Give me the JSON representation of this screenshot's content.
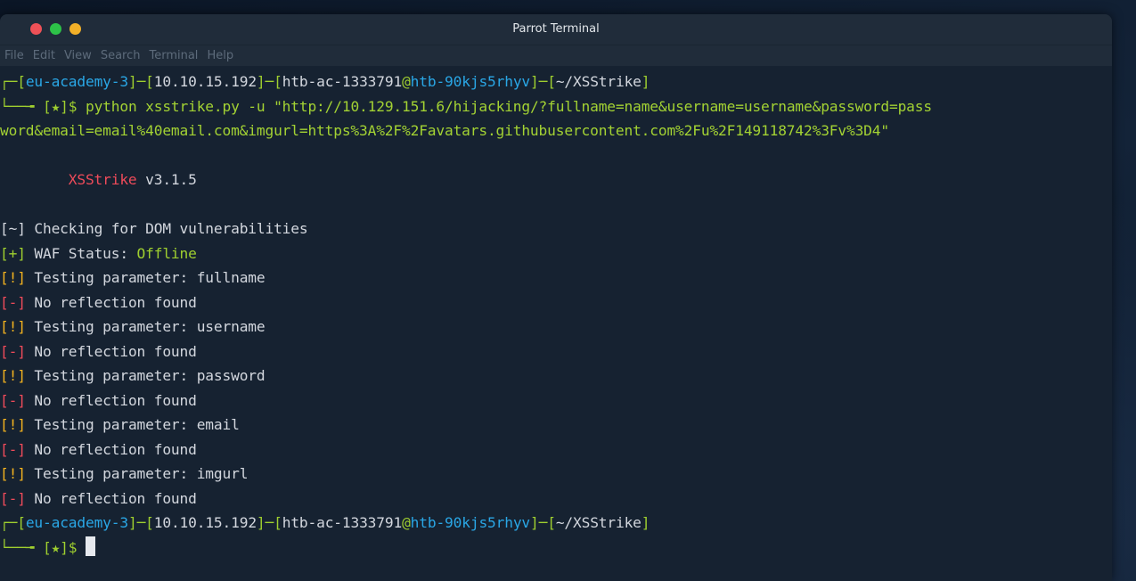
{
  "window": {
    "title": "Parrot Terminal"
  },
  "menu": [
    "File",
    "Edit",
    "View",
    "Search",
    "Terminal",
    "Help"
  ],
  "prompt": {
    "host_tag": "eu-academy-3",
    "ip": "10.10.15.192",
    "user": "htb-ac-1333791",
    "at": "@",
    "host": "htb-90kjs5rhyv",
    "cwd": "~/XSStrike",
    "star": "[★]$"
  },
  "command_line1": " python xsstrike.py -u \"http://10.129.151.6/hijacking/?fullname=name&username=username&password=pass",
  "command_line2": "word&email=email%40email.com&imgurl=https%3A%2F%2Favatars.githubusercontent.com%2Fu%2F149118742%3Fv%3D4\"",
  "banner": {
    "name": "XSStrike",
    "version": " v3.1.5"
  },
  "output": [
    {
      "tag": "[~]",
      "color": "w",
      "text": " Checking for DOM vulnerabilities"
    },
    {
      "tag": "[+]",
      "color": "g",
      "text": " WAF Status: ",
      "extra": "Offline"
    },
    {
      "tag": "[!]",
      "color": "y",
      "text": " Testing parameter: fullname"
    },
    {
      "tag": "[-]",
      "color": "r",
      "text": " No reflection found"
    },
    {
      "tag": "[!]",
      "color": "y",
      "text": " Testing parameter: username"
    },
    {
      "tag": "[-]",
      "color": "r",
      "text": " No reflection found"
    },
    {
      "tag": "[!]",
      "color": "y",
      "text": " Testing parameter: password"
    },
    {
      "tag": "[-]",
      "color": "r",
      "text": " No reflection found"
    },
    {
      "tag": "[!]",
      "color": "y",
      "text": " Testing parameter: email"
    },
    {
      "tag": "[-]",
      "color": "r",
      "text": " No reflection found"
    },
    {
      "tag": "[!]",
      "color": "y",
      "text": " Testing parameter: imgurl"
    },
    {
      "tag": "[-]",
      "color": "r",
      "text": " No reflection found"
    }
  ],
  "colors": {
    "green": "#9fcf2f",
    "blue": "#2aa7e6",
    "red": "#ef4b5a",
    "yellow": "#f3b21f",
    "text": "#d3d7de",
    "background": "#162231"
  }
}
